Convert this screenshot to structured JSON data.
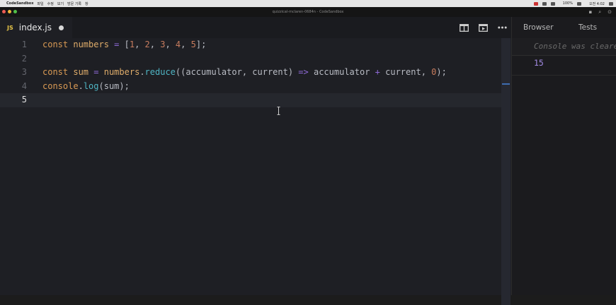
{
  "menubar": {
    "apple": "",
    "app": "CodeSandbox",
    "items": [
      "파일",
      "수정",
      "보기",
      "방문 기록",
      "창"
    ],
    "battery": "100%",
    "clock": "오전 4:02"
  },
  "window": {
    "title": "quizzical-mclaren-0684n - CodeSandbox"
  },
  "tab": {
    "icon_text": "JS",
    "filename": "index.js"
  },
  "editor": {
    "active_line": 5,
    "lines": [
      {
        "n": "1",
        "tokens": [
          [
            "kw",
            "const "
          ],
          [
            "var",
            "numbers"
          ],
          [
            "op",
            " = "
          ],
          [
            "pl",
            "["
          ],
          [
            "num",
            "1"
          ],
          [
            "pl",
            ", "
          ],
          [
            "num",
            "2"
          ],
          [
            "pl",
            ", "
          ],
          [
            "num",
            "3"
          ],
          [
            "pl",
            ", "
          ],
          [
            "num",
            "4"
          ],
          [
            "pl",
            ", "
          ],
          [
            "num",
            "5"
          ],
          [
            "pl",
            "];"
          ]
        ]
      },
      {
        "n": "2",
        "tokens": []
      },
      {
        "n": "3",
        "tokens": [
          [
            "kw",
            "const "
          ],
          [
            "var",
            "sum"
          ],
          [
            "op",
            " = "
          ],
          [
            "var",
            "numbers"
          ],
          [
            "pl",
            "."
          ],
          [
            "fn",
            "reduce"
          ],
          [
            "pl",
            "((accumulator, current) "
          ],
          [
            "op",
            "=>"
          ],
          [
            "pl",
            " accumulator "
          ],
          [
            "op",
            "+"
          ],
          [
            "pl",
            " current, "
          ],
          [
            "num",
            "0"
          ],
          [
            "pl",
            ");"
          ]
        ]
      },
      {
        "n": "4",
        "tokens": [
          [
            "kw",
            "console"
          ],
          [
            "pl",
            "."
          ],
          [
            "fn",
            "log"
          ],
          [
            "pl",
            "(sum);"
          ]
        ]
      },
      {
        "n": "5",
        "tokens": []
      }
    ]
  },
  "panel": {
    "tabs": [
      "Browser",
      "Tests"
    ],
    "console_message": "Console was cleared",
    "output": "15"
  },
  "colors": {
    "editor_bg": "#1e1f24",
    "keyword": "#d99a54",
    "number": "#c77c5e",
    "operator": "#8f6ad9",
    "function": "#4fb5c4",
    "console_output": "#a48ce6"
  }
}
